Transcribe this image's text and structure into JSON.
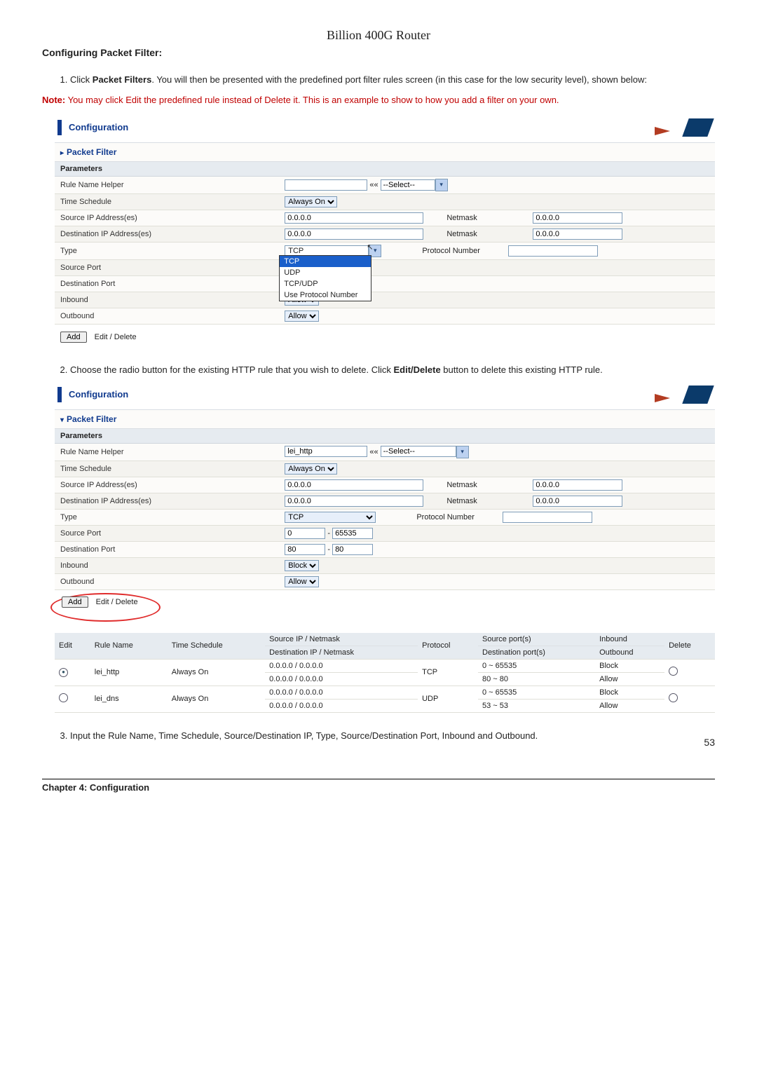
{
  "page_header": "Billion 400G Router",
  "page_number": "53",
  "chapter": "Chapter 4: Configuration",
  "section_title": "Configuring Packet Filter:",
  "steps": {
    "step1_pre": "Click ",
    "step1_bold": "Packet Filters",
    "step1_post": ". You will then be presented with the predefined port filter rules screen (in this case for the low security level), shown below:",
    "step2_pre": "Choose the radio button for the existing HTTP rule that you wish to delete. Click ",
    "step2_bold": "Edit/Delete",
    "step2_post": " button to delete this existing HTTP rule.",
    "step3": "Input the Rule Name, Time Schedule, Source/Destination IP, Type, Source/Destination Port, Inbound and Outbound."
  },
  "note": {
    "label": "Note:",
    "text": " You may click Edit the predefined rule instead of Delete it. This is an example to show to how you add a filter on your own."
  },
  "panel": {
    "configuration": "Configuration",
    "packet_filter": "Packet Filter",
    "parameters": "Parameters",
    "rule_name_helper": "Rule Name Helper",
    "select_placeholder": "--Select--",
    "time_schedule": "Time Schedule",
    "always_on": "Always On",
    "source_ip": "Source IP Address(es)",
    "dest_ip": "Destination IP Address(es)",
    "netmask": "Netmask",
    "zero_ip": "0.0.0.0",
    "type": "Type",
    "tcp": "TCP",
    "protocol_number": "Protocol Number",
    "source_port": "Source Port",
    "dest_port": "Destination Port",
    "inbound": "Inbound",
    "outbound": "Outbound",
    "allow": "Allow",
    "block": "Block",
    "add": "Add",
    "edit_delete": "Edit / Delete",
    "helper_arrows": "««",
    "type_options": [
      "TCP",
      "UDP",
      "TCP/UDP",
      "Use Protocol Number"
    ]
  },
  "panel2": {
    "rule_name_value": "lei_http",
    "src_port_from": "0",
    "src_port_to": "65535",
    "dst_port_from": "80",
    "dst_port_to": "80"
  },
  "rules_table": {
    "headers": {
      "edit": "Edit",
      "rule_name": "Rule Name",
      "time_schedule": "Time Schedule",
      "src_ip_net": "Source IP / Netmask",
      "dst_ip_net": "Destination IP / Netmask",
      "protocol": "Protocol",
      "src_ports": "Source port(s)",
      "dst_ports": "Destination port(s)",
      "inbound": "Inbound",
      "outbound": "Outbound",
      "delete": "Delete"
    },
    "rows": [
      {
        "selected": true,
        "rule_name": "lei_http",
        "time_schedule": "Always On",
        "src_ip": "0.0.0.0 / 0.0.0.0",
        "dst_ip": "0.0.0.0 / 0.0.0.0",
        "protocol": "TCP",
        "src_ports": "0 ~ 65535",
        "dst_ports": "80 ~ 80",
        "inbound": "Block",
        "outbound": "Allow"
      },
      {
        "selected": false,
        "rule_name": "lei_dns",
        "time_schedule": "Always On",
        "src_ip": "0.0.0.0 / 0.0.0.0",
        "dst_ip": "0.0.0.0 / 0.0.0.0",
        "protocol": "UDP",
        "src_ports": "0 ~ 65535",
        "dst_ports": "53 ~ 53",
        "inbound": "Block",
        "outbound": "Allow"
      }
    ]
  }
}
